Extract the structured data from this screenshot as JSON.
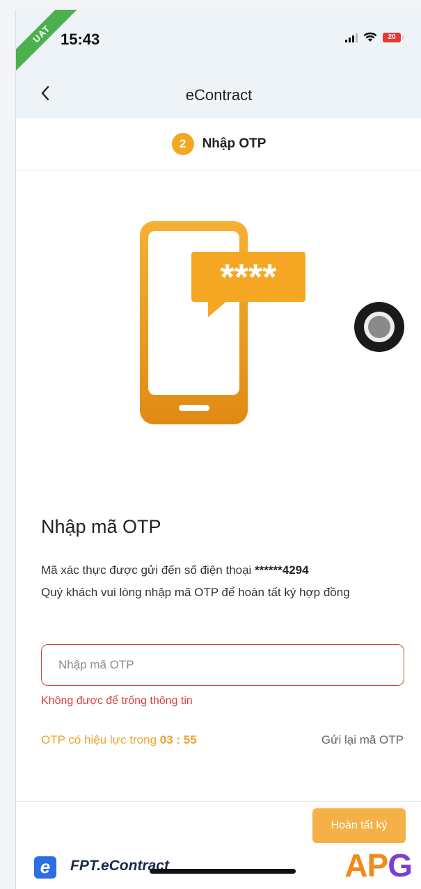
{
  "status_bar": {
    "badge": "UAT",
    "time": "15:43",
    "battery_level": "20"
  },
  "nav": {
    "back_icon": "chevron-left-icon",
    "title": "eContract"
  },
  "step": {
    "number": "2",
    "label": "Nhập OTP"
  },
  "illustration": {
    "bubble_text": "****",
    "colors": {
      "accent": "#f5a623"
    }
  },
  "form": {
    "heading": "Nhập mã OTP",
    "desc_line1_prefix": "Mã xác thực được gửi đến số điện thoại ",
    "phone_masked": "******4294",
    "desc_line2": "Quý khách vui lòng nhập mã OTP để hoàn tất ký hợp đồng",
    "otp_value": "",
    "otp_placeholder": "Nhập mã OTP",
    "error": "Không được để trống thông tin",
    "timer_prefix": "OTP có hiệu lực trong ",
    "timer_value": "03 : 55",
    "resend": "Gửi lại mã OTP"
  },
  "actions": {
    "finish": "Hoàn tất ký"
  },
  "footer": {
    "brand_left": "FPT.eContract",
    "brand_right_prefix": "AP",
    "brand_right_suffix": "G"
  }
}
